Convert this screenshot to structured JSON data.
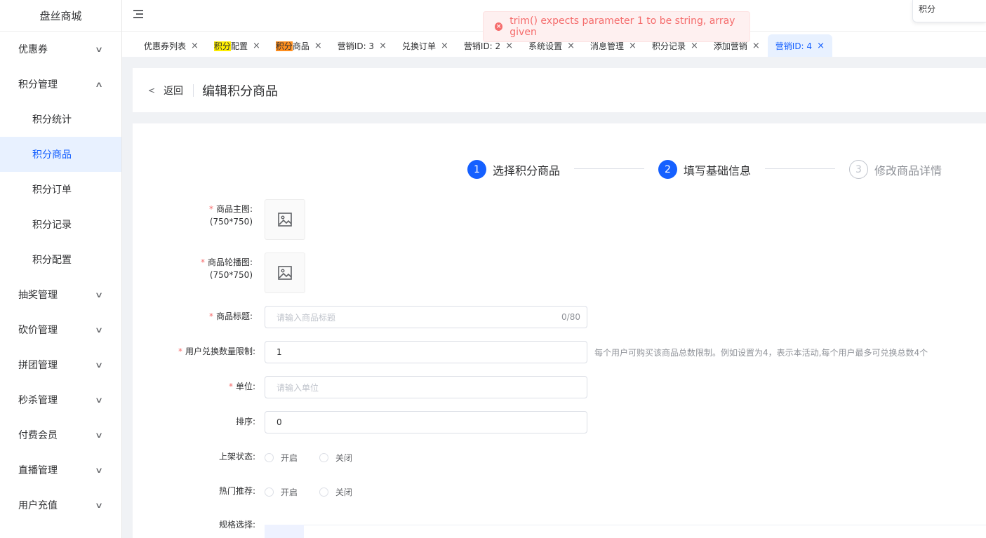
{
  "sidebar": {
    "logo": "盘丝商城",
    "menu_coupon": "优惠券",
    "menu_points": "积分管理",
    "sub_items": [
      "积分统计",
      "积分商品",
      "积分订单",
      "积分记录",
      "积分配置"
    ],
    "menu_rest": [
      "抽奖管理",
      "砍价管理",
      "拼团管理",
      "秒杀管理",
      "付费会员",
      "直播管理",
      "用户充值"
    ],
    "active_sub": "积分商品"
  },
  "topbar": {
    "hamburger_icon": "menu-fold-icon",
    "search_value": "积分"
  },
  "tabs": [
    {
      "pre": "",
      "hl": "",
      "post": "优惠券列表"
    },
    {
      "pre": "",
      "hl": "积分",
      "hl_color": "yellow",
      "post": "配置"
    },
    {
      "pre": "",
      "hl": "积分",
      "hl_color": "orange",
      "post": "商品"
    },
    {
      "pre": "",
      "hl": "",
      "post": "营销ID: 3"
    },
    {
      "pre": "",
      "hl": "",
      "post": "兑换订单"
    },
    {
      "pre": "",
      "hl": "",
      "post": "营销ID: 2"
    },
    {
      "pre": "",
      "hl": "",
      "post": "系统设置"
    },
    {
      "pre": "",
      "hl": "",
      "post": "消息管理"
    },
    {
      "pre": "",
      "hl": "",
      "post": "积分记录"
    },
    {
      "pre": "",
      "hl": "",
      "post": "添加营销"
    },
    {
      "pre": "",
      "hl": "",
      "post": "营销ID: 4",
      "active": true
    }
  ],
  "toast": {
    "message": "trim() expects parameter 1 to be string, array given",
    "color": "#f56c6c"
  },
  "header": {
    "back_label": "返回",
    "title": "编辑积分商品"
  },
  "steps": [
    {
      "num": "1",
      "label": "选择积分商品",
      "state": "done"
    },
    {
      "num": "2",
      "label": "填写基础信息",
      "state": "done"
    },
    {
      "num": "3",
      "label": "修改商品详情",
      "state": "todo"
    }
  ],
  "form": {
    "main_image_label": "商品主图:",
    "main_image_size": "(750*750)",
    "carousel_label": "商品轮播图:",
    "carousel_size": "(750*750)",
    "title_label": "商品标题:",
    "title_placeholder": "请输入商品标题",
    "title_count": "0/80",
    "limit_label": "用户兑换数量限制:",
    "limit_value": "1",
    "limit_hint": "每个用户可购买该商品总数限制。例如设置为4，表示本活动,每个用户最多可兑换总数4个",
    "unit_label": "单位:",
    "unit_placeholder": "请输入单位",
    "sort_label": "排序:",
    "sort_value": "0",
    "shelf_label": "上架状态:",
    "hot_label": "热门推荐:",
    "on_label": "开启",
    "off_label": "关闭",
    "spec_label": "规格选择:"
  },
  "colors": {
    "primary": "#1560ff",
    "active_bg": "#e8f1ff",
    "required": "#f56c6c"
  }
}
